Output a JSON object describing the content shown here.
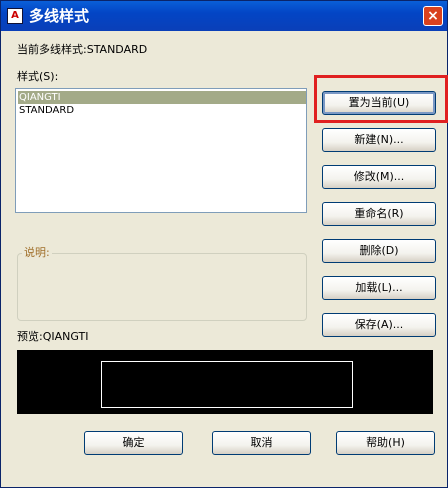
{
  "window": {
    "title": "多线样式",
    "app_icon_text": "A"
  },
  "current_style_label": "当前多线样式:STANDARD",
  "styles_label": "样式(S):",
  "styles": [
    "QIANGTI",
    "STANDARD"
  ],
  "selected_index": 0,
  "description_label": "说明:",
  "preview_label": "预览:QIANGTI",
  "side_buttons": {
    "set_current": "置为当前(U)",
    "new": "新建(N)...",
    "modify": "修改(M)...",
    "rename": "重命名(R)",
    "delete": "删除(D)",
    "load": "加载(L)...",
    "save": "保存(A)..."
  },
  "bottom_buttons": {
    "ok": "确定",
    "cancel": "取消",
    "help": "帮助(H)"
  },
  "close_glyph": "×",
  "colors": {
    "highlight": "#e02020",
    "selection": "#a3aa88",
    "title_bar": "#0345c5"
  }
}
